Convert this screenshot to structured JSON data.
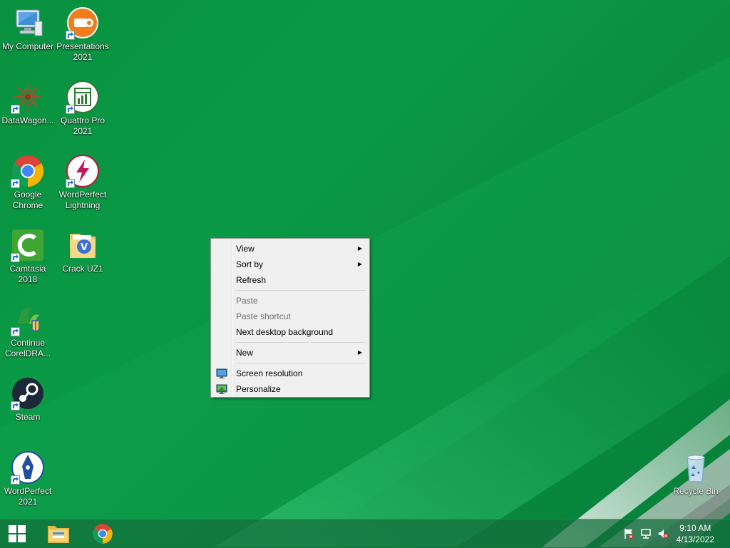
{
  "desktop": {
    "icons": [
      {
        "label": "My Computer",
        "icon": "computer-icon"
      },
      {
        "label": "Presentations\n2021",
        "icon": "presentations-icon"
      },
      {
        "label": "DataWagon...",
        "icon": "datawagon-icon"
      },
      {
        "label": "Quattro Pro\n2021",
        "icon": "quattro-pro-icon"
      },
      {
        "label": "Google\nChrome",
        "icon": "chrome-icon"
      },
      {
        "label": "WordPerfect\nLightning",
        "icon": "wordperfect-lightning-icon"
      },
      {
        "label": "Camtasia\n2018",
        "icon": "camtasia-icon"
      },
      {
        "label": "Crack UZ1",
        "icon": "folder-icon"
      },
      {
        "label": "Continue\nCorelDRA...",
        "icon": "coreldraw-setup-icon"
      },
      {
        "label": "Steam",
        "icon": "steam-icon"
      },
      {
        "label": "WordPerfect\n2021",
        "icon": "wordperfect-icon"
      },
      {
        "label": "Recycle Bin",
        "icon": "recycle-bin-icon"
      }
    ]
  },
  "context_menu": {
    "view": "View",
    "sort_by": "Sort by",
    "refresh": "Refresh",
    "paste": "Paste",
    "paste_shortcut": "Paste shortcut",
    "next_background": "Next desktop background",
    "new": "New",
    "screen_resolution": "Screen resolution",
    "personalize": "Personalize"
  },
  "taskbar": {
    "start": "windows-logo-icon",
    "pinned": [
      "file-explorer-icon",
      "chrome-icon"
    ],
    "tray": [
      "action-center-flag-icon",
      "network-icon",
      "volume-muted-icon"
    ],
    "time": "9:10 AM",
    "date": "4/13/2022"
  }
}
